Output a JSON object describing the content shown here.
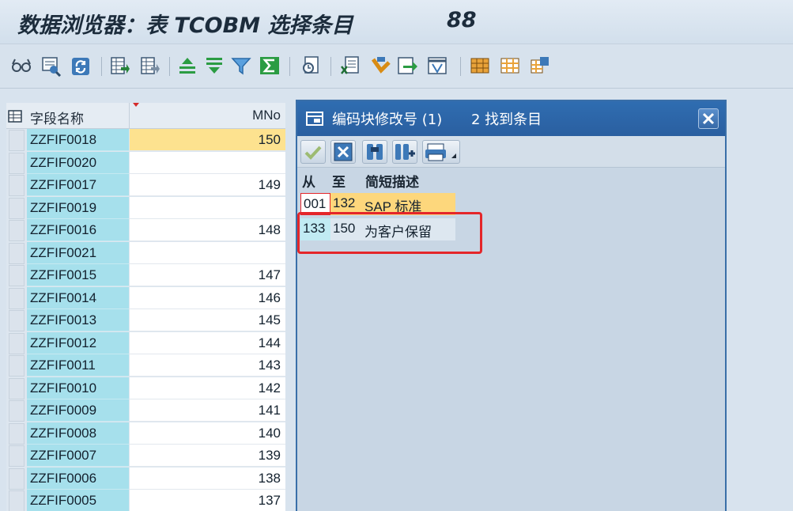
{
  "title": {
    "text": "数据浏览器：表 TCOBM 选择条目",
    "count": "88"
  },
  "toolbar": {
    "icons": [
      "glasses-icon",
      "details-icon",
      "refresh-icon",
      "check-table-icon",
      "check-table-alt-icon",
      "sort-ascending-icon",
      "sort-descending-icon",
      "filter-icon",
      "sum-icon",
      "print-preview-icon",
      "excel-export-icon",
      "word-processing-icon",
      "local-file-icon",
      "abc-analysis-icon",
      "layout-select-icon",
      "layout-change-icon",
      "layout-save-icon"
    ]
  },
  "table": {
    "headers": {
      "field": "字段名称",
      "value": "MNo"
    },
    "rows": [
      {
        "field": "ZZFIF0018",
        "value": "150"
      },
      {
        "field": "ZZFIF0020",
        "value": ""
      },
      {
        "field": "ZZFIF0017",
        "value": "149"
      },
      {
        "field": "ZZFIF0019",
        "value": ""
      },
      {
        "field": "ZZFIF0016",
        "value": "148"
      },
      {
        "field": "ZZFIF0021",
        "value": ""
      },
      {
        "field": "ZZFIF0015",
        "value": "147"
      },
      {
        "field": "ZZFIF0014",
        "value": "146"
      },
      {
        "field": "ZZFIF0013",
        "value": "145"
      },
      {
        "field": "ZZFIF0012",
        "value": "144"
      },
      {
        "field": "ZZFIF0011",
        "value": "143"
      },
      {
        "field": "ZZFIF0010",
        "value": "142"
      },
      {
        "field": "ZZFIF0009",
        "value": "141"
      },
      {
        "field": "ZZFIF0008",
        "value": "140"
      },
      {
        "field": "ZZFIF0007",
        "value": "139"
      },
      {
        "field": "ZZFIF0006",
        "value": "138"
      },
      {
        "field": "ZZFIF0005",
        "value": "137"
      }
    ]
  },
  "dialog": {
    "title": "编码块修改号 (1)",
    "found": "2 找到条目",
    "columns": {
      "from": "从",
      "to": "至",
      "desc": "简短描述"
    },
    "rows": [
      {
        "from": "001",
        "to": "132",
        "desc": "SAP 标准"
      },
      {
        "from": "133",
        "to": "150",
        "desc": "为客户保留"
      }
    ]
  },
  "colors": {
    "accent": "#2f6db1",
    "highlight": "#fde28f",
    "key_cell": "#a6e0ec",
    "annotation": "#e4262a"
  }
}
